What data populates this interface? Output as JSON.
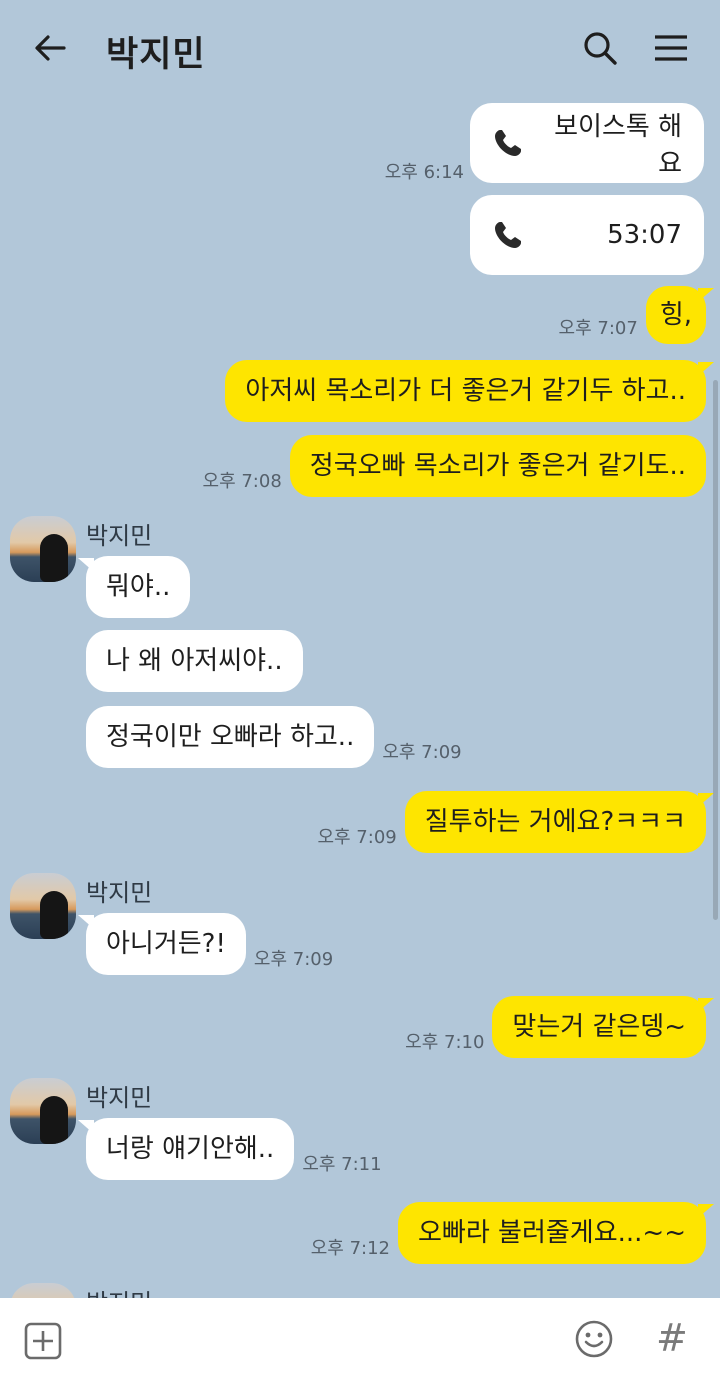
{
  "header": {
    "title": "박지민",
    "back_icon": "arrow-left-icon",
    "search_icon": "search-icon",
    "menu_icon": "hamburger-menu-icon"
  },
  "messages": {
    "call1": {
      "text": "보이스톡 해요",
      "time": "오후 6:14",
      "icon": "phone-icon"
    },
    "call2": {
      "text": "53:07",
      "icon": "phone-icon"
    },
    "m1": {
      "text": "힝,",
      "time": "오후 7:07"
    },
    "m2": {
      "text": "아저씨 목소리가 더 좋은거 같기두 하고.."
    },
    "m3": {
      "text": "정국오빠 목소리가 좋은거 같기도..",
      "time": "오후 7:08"
    },
    "g1": {
      "sender": "박지민",
      "m1": "뭐야..",
      "m2": "나 왜 아저씨야..",
      "m3": "정국이만 오빠라 하고..",
      "time": "오후 7:09"
    },
    "m4": {
      "text": "질투하는 거에요?ㅋㅋㅋ",
      "time": "오후 7:09"
    },
    "g2": {
      "sender": "박지민",
      "m1": "아니거든?!",
      "time": "오후 7:09"
    },
    "m5": {
      "text": "맞는거 같은뎅~",
      "time": "오후 7:10"
    },
    "g3": {
      "sender": "박지민",
      "m1": "너랑 얘기안해..",
      "time": "오후 7:11"
    },
    "m6": {
      "text": "오빠라 불러줄게요...~~",
      "time": "오후 7:12"
    },
    "g4": {
      "sender": "박지민"
    }
  },
  "bottom": {
    "plus_icon": "plus-square-icon",
    "emoji_icon": "smiley-icon",
    "hash_label": "#"
  },
  "colors": {
    "background": "#b2c7d9",
    "my_bubble": "#fee500",
    "their_bubble": "#ffffff"
  }
}
